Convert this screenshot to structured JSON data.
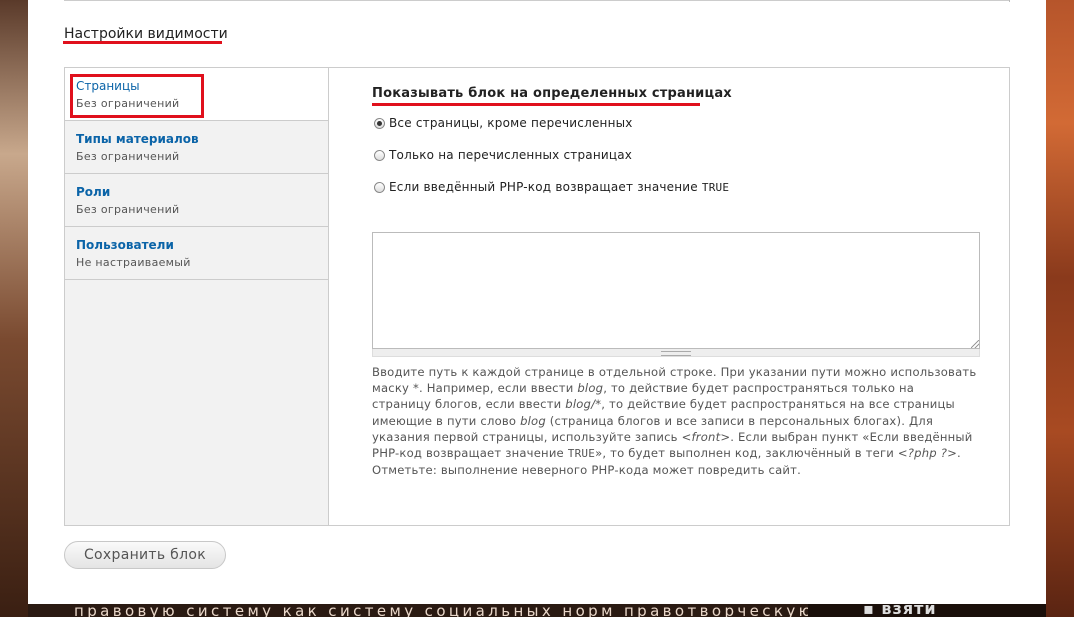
{
  "section": {
    "title": "Настройки видимости"
  },
  "tabs": [
    {
      "label": "Страницы",
      "summary": "Без ограничений"
    },
    {
      "label": "Типы материалов",
      "summary": "Без ограничений"
    },
    {
      "label": "Роли",
      "summary": "Без ограничений"
    },
    {
      "label": "Пользователи",
      "summary": "Не настраиваемый"
    }
  ],
  "pane": {
    "title": "Показывать блок на определенных страницах",
    "options": [
      {
        "label": "Все страницы, кроме перечисленных",
        "checked": true
      },
      {
        "label": "Только на перечисленных страницах",
        "checked": false
      },
      {
        "label_prefix": "Если введённый PHP-код возвращает значение ",
        "label_code": "TRUE",
        "checked": false
      }
    ],
    "textarea_value": "",
    "description": {
      "l1": "Вводите путь к каждой странице в отдельной строке. При указании пути можно использовать",
      "l2a": "маску *. Например, если ввести ",
      "l2b": "blog",
      "l2c": ", то действие будет распространяться только на",
      "l3a": "страницу блогов, если ввести ",
      "l3b": "blog/*",
      "l3c": ", то действие будет распространяться на все страницы",
      "l4a": "имеющие в пути слово ",
      "l4b": "blog",
      "l4c": " (страница блогов и все записи в персональных блогах). Для",
      "l5a": "указания первой страницы, используйте запись ",
      "l5b": "<front>",
      "l5c": ". Если выбран пункт «Если введённый",
      "l6a": "PHP-код возвращает значение ",
      "l6b": "TRUE",
      "l6c": "», то будет выполнен код, заключённый в теги ",
      "l6d": "<?php ?>",
      "l6e": ".",
      "l7": "Отметьте: выполнение неверного PHP-кода может повредить сайт."
    }
  },
  "actions": {
    "save_label": "Сохранить блок"
  },
  "background": {
    "bottom_text": "правовую   систему   как   систему   социальных   норм   правотворческую   и",
    "bottom_right_text": "▪ взяти"
  },
  "colors": {
    "tab_link": "#0b64a8",
    "highlight": "#e0101c"
  }
}
